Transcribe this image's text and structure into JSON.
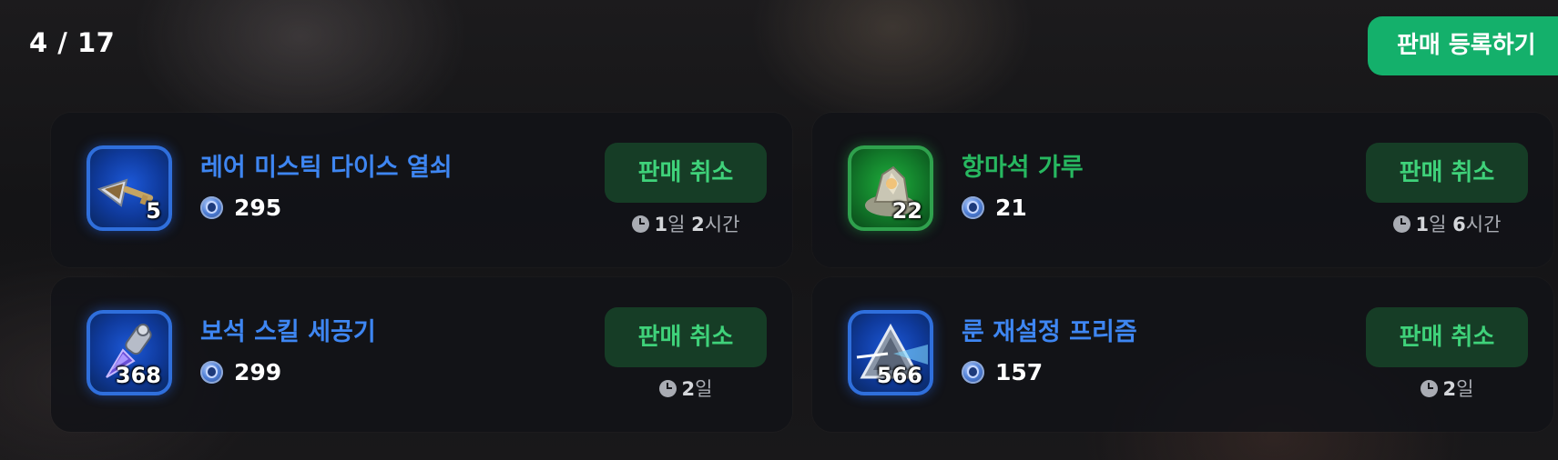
{
  "header": {
    "counter": "4 / 17",
    "register_label": "판매 등록하기"
  },
  "listings": [
    {
      "name": "레어 미스틱 다이스 열쇠",
      "count": "5",
      "price": "295",
      "cancel_label": "판매 취소",
      "time_remaining": "1일 2시간",
      "rarity_color": "#3e86f2",
      "icon": "key-icon"
    },
    {
      "name": "항마석 가루",
      "count": "22",
      "price": "21",
      "cancel_label": "판매 취소",
      "time_remaining": "1일 6시간",
      "rarity_color": "#27b860",
      "icon": "stone-powder-icon"
    },
    {
      "name": "보석 스킬 세공기",
      "count": "368",
      "price": "299",
      "cancel_label": "판매 취소",
      "time_remaining": "2일",
      "rarity_color": "#3e86f2",
      "icon": "gem-chisel-icon"
    },
    {
      "name": "룬 재설정 프리즘",
      "count": "566",
      "price": "157",
      "cancel_label": "판매 취소",
      "time_remaining": "2일",
      "rarity_color": "#3e86f2",
      "icon": "prism-icon"
    }
  ],
  "currency_icon": "blue-coin-icon",
  "time_icon": "clock-icon",
  "colors": {
    "accent_green": "#14b06b",
    "cancel_bg": "#163d26",
    "cancel_text": "#3fd27a",
    "rare_blue": "#3e86f2",
    "uncommon_green": "#27b860"
  }
}
